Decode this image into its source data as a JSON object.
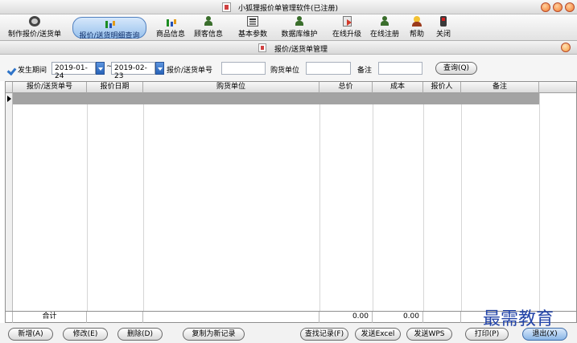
{
  "window": {
    "title": "小狐狸报价单管理软件(已注册)"
  },
  "toolbar": {
    "items": [
      {
        "label": "制作报价/送货单",
        "icon": "gear-icon"
      },
      {
        "label": "报价/送货明细查询",
        "icon": "chart-icon",
        "active": true
      },
      {
        "label": "商品信息",
        "icon": "chart-icon"
      },
      {
        "label": "顾客信息",
        "icon": "person-icon"
      },
      {
        "label": "基本参数",
        "icon": "calculator-icon"
      },
      {
        "label": "数据库维护",
        "icon": "person-icon"
      },
      {
        "label": "在线升级",
        "icon": "upgrade-icon"
      },
      {
        "label": "在线注册",
        "icon": "person-icon"
      },
      {
        "label": "帮助",
        "icon": "help-icon"
      },
      {
        "label": "关闭",
        "icon": "close-icon"
      }
    ]
  },
  "subwindow": {
    "title": "报价/送货单管理"
  },
  "filter": {
    "period_label": "发生期间",
    "date_from": "2019-01-24",
    "separator": "~",
    "date_to": "2019-02-23",
    "order_no_label": "报价/送货单号",
    "order_no_value": "",
    "buyer_label": "购货单位",
    "buyer_value": "",
    "remark_label": "备注",
    "remark_value": "",
    "query_button": "查询(Q)"
  },
  "table": {
    "columns": [
      "报价/送货单号",
      "报价日期",
      "购货单位",
      "总价",
      "成本",
      "报价人",
      "备注"
    ],
    "rows": []
  },
  "totals": {
    "label": "合计",
    "total_price": "0.00",
    "total_cost": "0.00"
  },
  "buttons": {
    "add": "新增(A)",
    "edit": "修改(E)",
    "delete": "删除(D)",
    "copy": "复制为新记录",
    "find": "查找记录(F)",
    "send_excel": "发送Excel",
    "send_wps": "发送WPS",
    "print": "打印(P)",
    "exit": "退出(X)"
  },
  "watermark": "最需教育"
}
